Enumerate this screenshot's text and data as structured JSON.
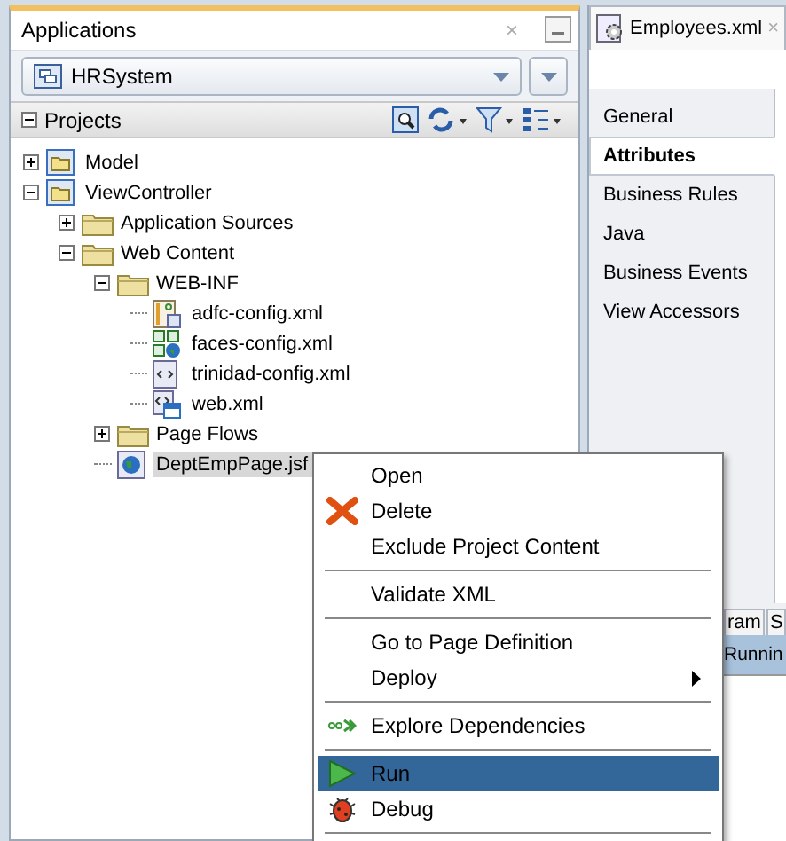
{
  "applications_panel": {
    "title": "Applications",
    "close": "×",
    "application": "HRSystem"
  },
  "projects": {
    "title": "Projects",
    "tree": [
      {
        "label": "Model",
        "kind": "project",
        "expanded": false,
        "selected": false
      },
      {
        "label": "ViewController",
        "kind": "project",
        "expanded": true,
        "selected": false,
        "children": [
          {
            "label": "Application Sources",
            "kind": "folder",
            "expanded": false,
            "selected": false
          },
          {
            "label": "Web Content",
            "kind": "folder",
            "expanded": true,
            "selected": false,
            "children": [
              {
                "label": "WEB-INF",
                "kind": "folder",
                "expanded": true,
                "selected": false,
                "children": [
                  {
                    "label": "adfc-config.xml",
                    "kind": "adfc",
                    "selected": false
                  },
                  {
                    "label": "faces-config.xml",
                    "kind": "faces",
                    "selected": false
                  },
                  {
                    "label": "trinidad-config.xml",
                    "kind": "xml",
                    "selected": false
                  },
                  {
                    "label": "web.xml",
                    "kind": "webxml",
                    "selected": false
                  }
                ]
              },
              {
                "label": "Page Flows",
                "kind": "folder",
                "expanded": false,
                "selected": false
              },
              {
                "label": "DeptEmpPage.jsf",
                "kind": "jsf",
                "selected": true
              }
            ]
          }
        ]
      }
    ]
  },
  "editor": {
    "tab": "Employees.xml",
    "close": "×",
    "sections": [
      {
        "label": "General",
        "selected": false
      },
      {
        "label": "Attributes",
        "selected": true
      },
      {
        "label": "Business Rules",
        "selected": false
      },
      {
        "label": "Java",
        "selected": false
      },
      {
        "label": "Business Events",
        "selected": false
      },
      {
        "label": "View Accessors",
        "selected": false
      }
    ]
  },
  "bottom_panel": {
    "tabs": [
      "ram",
      "S"
    ],
    "row": "Runnin"
  },
  "context_menu": [
    {
      "kind": "plain",
      "label": "Open",
      "selected": false
    },
    {
      "kind": "delete",
      "label": "Delete",
      "selected": false
    },
    {
      "kind": "plain",
      "label": "Exclude Project Content",
      "selected": false
    },
    {
      "kind": "separator"
    },
    {
      "kind": "plain",
      "label": "Validate XML",
      "selected": false
    },
    {
      "kind": "separator"
    },
    {
      "kind": "plain",
      "label": "Go to Page Definition",
      "selected": false
    },
    {
      "kind": "plain",
      "label": "Deploy",
      "selected": false,
      "submenu": true
    },
    {
      "kind": "separator"
    },
    {
      "kind": "explore",
      "label": "Explore Dependencies",
      "selected": false
    },
    {
      "kind": "separator"
    },
    {
      "kind": "run",
      "label": "Run",
      "selected": true
    },
    {
      "kind": "debug",
      "label": "Debug",
      "selected": false
    },
    {
      "kind": "separator"
    }
  ]
}
